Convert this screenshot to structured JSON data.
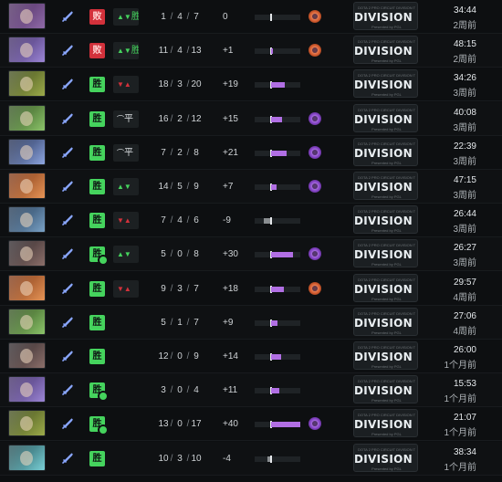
{
  "league_banner": {
    "small_text": "DOTA 2 PRO CIRCUIT DIVISION TOUR",
    "name": "DIVISION I",
    "sub_text": "Presented by PGL"
  },
  "colors": {
    "win": "#45d35d",
    "loss": "#d3313b",
    "impact_bar": "#b16fe4"
  },
  "matches": [
    {
      "hero_icon": "hero-portrait",
      "hero_colors": [
        "#4a2b5e",
        "#8f6aa8"
      ],
      "result": "loss",
      "result_label": "败",
      "party_result": "win",
      "party_label": "胜",
      "kills": "1",
      "deaths": "4",
      "assists": "7",
      "impact": "0",
      "impact_value": 0,
      "medal": "orange",
      "duration": "34:44",
      "time_ago": "2周前"
    },
    {
      "hero_icon": "hero-portrait",
      "hero_colors": [
        "#3d2a63",
        "#9c86d6"
      ],
      "result": "loss",
      "result_label": "败",
      "party_result": "win",
      "party_label": "胜",
      "kills": "11",
      "deaths": "4",
      "assists": "13",
      "impact": "+1",
      "impact_value": 1,
      "medal": "orange",
      "duration": "48:15",
      "time_ago": "2周前"
    },
    {
      "hero_icon": "hero-portrait",
      "hero_colors": [
        "#3e4a1c",
        "#9cab4a"
      ],
      "result": "win",
      "result_label": "胜",
      "party_result": "loss",
      "party_label": "",
      "kills": "18",
      "deaths": "3",
      "assists": "20",
      "impact": "+19",
      "impact_value": 19,
      "medal": "",
      "duration": "34:26",
      "time_ago": "3周前"
    },
    {
      "hero_icon": "hero-portrait",
      "hero_colors": [
        "#2f4e1d",
        "#8cc46a"
      ],
      "result": "win",
      "result_label": "胜",
      "party_result": "draw",
      "party_label": "平",
      "kills": "16",
      "deaths": "2",
      "assists": "12",
      "impact": "+15",
      "impact_value": 15,
      "medal": "purple",
      "duration": "40:08",
      "time_ago": "3周前"
    },
    {
      "hero_icon": "hero-portrait",
      "hero_colors": [
        "#1d2a4e",
        "#8ea6e0"
      ],
      "result": "win",
      "result_label": "胜",
      "party_result": "draw",
      "party_label": "平",
      "kills": "7",
      "deaths": "2",
      "assists": "8",
      "impact": "+21",
      "impact_value": 21,
      "medal": "purple",
      "duration": "22:39",
      "time_ago": "3周前"
    },
    {
      "hero_icon": "hero-portrait",
      "hero_colors": [
        "#7a3413",
        "#e69456"
      ],
      "result": "win",
      "result_label": "胜",
      "party_result": "win",
      "party_label": "",
      "kills": "14",
      "deaths": "5",
      "assists": "9",
      "impact": "+7",
      "impact_value": 7,
      "medal": "purple",
      "duration": "47:15",
      "time_ago": "3周前"
    },
    {
      "hero_icon": "hero-portrait",
      "hero_colors": [
        "#1e3550",
        "#7aa2c6"
      ],
      "result": "win",
      "result_label": "胜",
      "party_result": "loss",
      "party_label": "",
      "kills": "7",
      "deaths": "4",
      "assists": "6",
      "impact": "-9",
      "impact_value": -9,
      "medal": "",
      "duration": "26:44",
      "time_ago": "3周前"
    },
    {
      "hero_icon": "hero-portrait",
      "hero_colors": [
        "#2a2428",
        "#8c6f6a"
      ],
      "result": "win",
      "result_label": "胜",
      "party_result": "win",
      "party_label": "",
      "kills": "5",
      "deaths": "0",
      "assists": "8",
      "impact": "+30",
      "impact_value": 30,
      "medal": "purple",
      "party_badge": true,
      "duration": "26:27",
      "time_ago": "3周前"
    },
    {
      "hero_icon": "hero-portrait",
      "hero_colors": [
        "#7a3413",
        "#e69456"
      ],
      "result": "win",
      "result_label": "胜",
      "party_result": "loss",
      "party_label": "",
      "kills": "9",
      "deaths": "3",
      "assists": "7",
      "impact": "+18",
      "impact_value": 18,
      "medal": "orange",
      "duration": "29:57",
      "time_ago": "4周前"
    },
    {
      "hero_icon": "hero-portrait",
      "hero_colors": [
        "#2f4e1d",
        "#8cc46a"
      ],
      "result": "win",
      "result_label": "胜",
      "party_result": "none",
      "party_label": "",
      "kills": "5",
      "deaths": "1",
      "assists": "7",
      "impact": "+9",
      "impact_value": 9,
      "medal": "",
      "duration": "27:06",
      "time_ago": "4周前"
    },
    {
      "hero_icon": "hero-portrait",
      "hero_colors": [
        "#2a2428",
        "#8c6f6a"
      ],
      "result": "win",
      "result_label": "胜",
      "party_result": "none",
      "party_label": "",
      "kills": "12",
      "deaths": "0",
      "assists": "9",
      "impact": "+14",
      "impact_value": 14,
      "medal": "",
      "duration": "26:00",
      "time_ago": "1个月前"
    },
    {
      "hero_icon": "hero-portrait",
      "hero_colors": [
        "#3d2a63",
        "#9c86d6"
      ],
      "result": "win",
      "result_label": "胜",
      "party_result": "none",
      "party_label": "",
      "kills": "3",
      "deaths": "0",
      "assists": "4",
      "impact": "+11",
      "impact_value": 11,
      "medal": "",
      "party_badge": true,
      "duration": "15:53",
      "time_ago": "1个月前"
    },
    {
      "hero_icon": "hero-portrait",
      "hero_colors": [
        "#3e4a1c",
        "#9cab4a"
      ],
      "result": "win",
      "result_label": "胜",
      "party_result": "none",
      "party_label": "",
      "kills": "13",
      "deaths": "0",
      "assists": "17",
      "impact": "+40",
      "impact_value": 40,
      "medal": "purple",
      "party_badge": true,
      "duration": "21:07",
      "time_ago": "1个月前"
    },
    {
      "hero_icon": "hero-portrait",
      "hero_colors": [
        "#1e4a50",
        "#7ad0d6"
      ],
      "result": "win",
      "result_label": "胜",
      "party_result": "none",
      "party_label": "",
      "kills": "10",
      "deaths": "3",
      "assists": "10",
      "impact": "-4",
      "impact_value": -4,
      "medal": "",
      "duration": "38:34",
      "time_ago": "1个月前"
    }
  ]
}
